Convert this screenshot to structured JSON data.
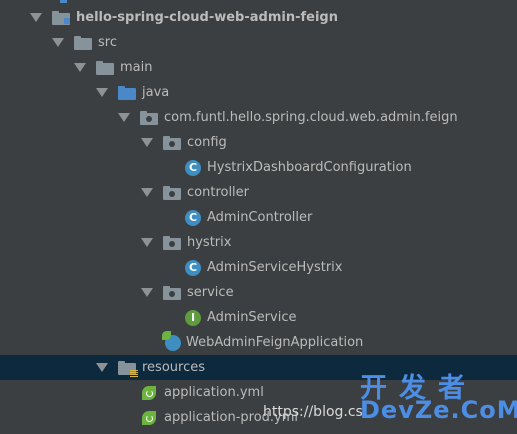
{
  "tree": {
    "rows": [
      {
        "label": "hello-spring-cloud-web-admin-feign"
      },
      {
        "label": "src"
      },
      {
        "label": "main"
      },
      {
        "label": "java"
      },
      {
        "label": "com.funtl.hello.spring.cloud.web.admin.feign"
      },
      {
        "label": "config"
      },
      {
        "label": "HystrixDashboardConfiguration",
        "icon_letter": "C"
      },
      {
        "label": "controller"
      },
      {
        "label": "AdminController",
        "icon_letter": "C"
      },
      {
        "label": "hystrix"
      },
      {
        "label": "AdminServiceHystrix",
        "icon_letter": "C"
      },
      {
        "label": "service"
      },
      {
        "label": "AdminService",
        "icon_letter": "I"
      },
      {
        "label": "WebAdminFeignApplication"
      },
      {
        "label": "resources"
      },
      {
        "label": "application.yml"
      },
      {
        "label": "application-prod.yml"
      }
    ]
  },
  "watermark": {
    "chinese": "开发者",
    "brand": "DevZe.CoM",
    "url": "https://blog.cs"
  },
  "colors": {
    "background": "#3c3f41",
    "selection": "#0d293e",
    "text": "#bbbbbb",
    "class_icon": "#3f8ec2",
    "interface_icon": "#5f9b3f",
    "spring_leaf": "#6db33f",
    "source_folder": "#4a88c7"
  }
}
